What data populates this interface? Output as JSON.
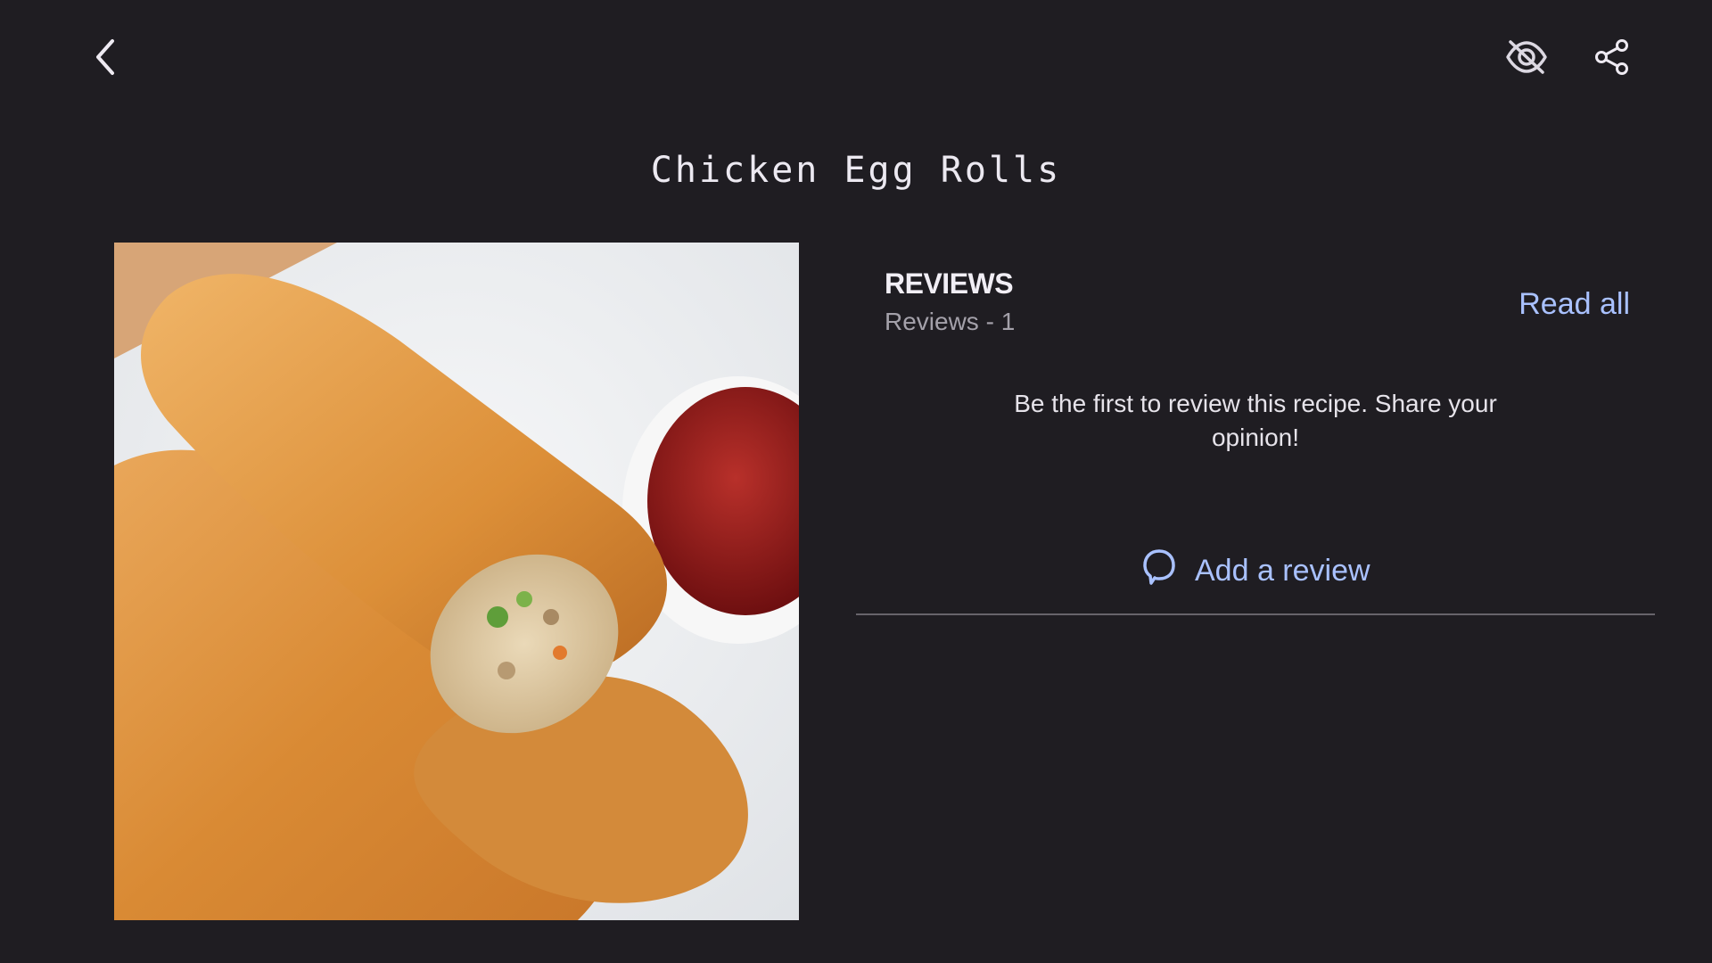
{
  "toolbar": {
    "back_icon": "chevron-left-icon",
    "hide_icon": "eye-off-icon",
    "share_icon": "share-icon"
  },
  "recipe": {
    "title": "Chicken Egg Rolls",
    "image_description": "Fried egg rolls with dipping sauce"
  },
  "reviews": {
    "heading": "REVIEWS",
    "count_label": "Reviews - 1",
    "read_all_label": "Read all",
    "empty_message": "Be the first to review this recipe. Share your opinion!",
    "add_review_label": "Add a review",
    "add_review_icon": "comment-icon"
  },
  "colors": {
    "background": "#1f1d22",
    "accent": "#a9c1ff",
    "text_primary": "#ece9f1",
    "text_secondary": "#a4a1aa",
    "divider": "#67646b"
  }
}
